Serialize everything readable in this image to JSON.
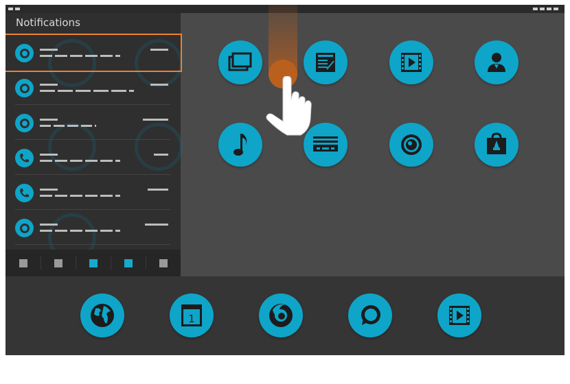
{
  "notifications_panel": {
    "title": "Notifications",
    "items": [
      {
        "icon": "ring-icon",
        "highlighted": true
      },
      {
        "icon": "ring-icon",
        "highlighted": false
      },
      {
        "icon": "ring-icon",
        "highlighted": false
      },
      {
        "icon": "phone-icon",
        "highlighted": false
      },
      {
        "icon": "phone-icon",
        "highlighted": false
      },
      {
        "icon": "ring-icon",
        "highlighted": false
      }
    ],
    "page_indicators": [
      {
        "active": false
      },
      {
        "active": false
      },
      {
        "active": true
      },
      {
        "active": true
      },
      {
        "active": false
      }
    ]
  },
  "home_grid": {
    "apps": [
      {
        "icon": "gallery-icon"
      },
      {
        "icon": "notes-icon"
      },
      {
        "icon": "video-player-icon"
      },
      {
        "icon": "contacts-icon"
      },
      {
        "icon": "music-icon"
      },
      {
        "icon": "radio-icon"
      },
      {
        "icon": "camera-icon"
      },
      {
        "icon": "app-store-icon"
      }
    ]
  },
  "dock": {
    "apps": [
      {
        "icon": "browser-globe-icon"
      },
      {
        "icon": "calendar-icon",
        "label": "1"
      },
      {
        "icon": "firefox-icon"
      },
      {
        "icon": "messages-icon"
      },
      {
        "icon": "video-icon"
      }
    ]
  },
  "gesture": {
    "type": "swipe-down",
    "icon": "hand-pointer-icon"
  },
  "colors": {
    "accent": "#0ea5c9",
    "highlight": "#f0822e",
    "panel": "#2f2f2f",
    "background": "#4a4a4a",
    "dock": "#353535"
  }
}
